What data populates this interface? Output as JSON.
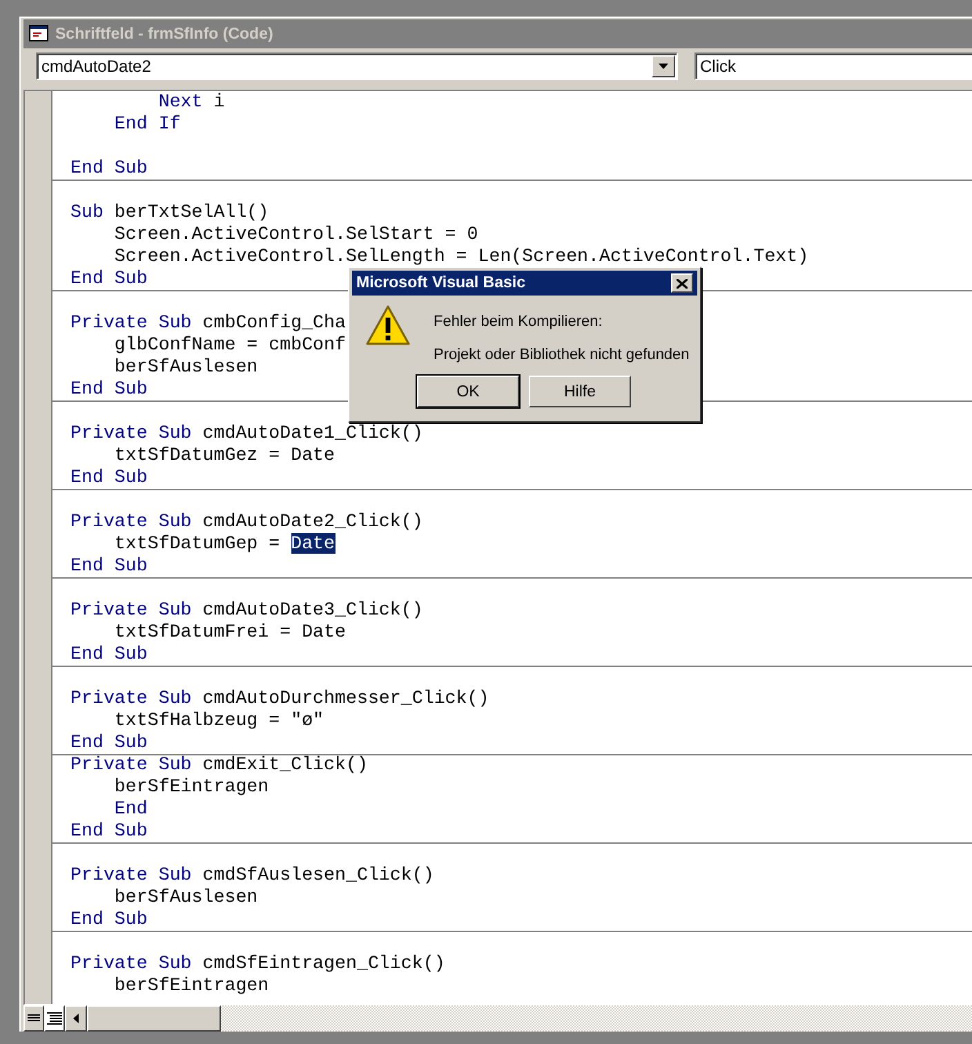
{
  "window": {
    "title": "Schriftfeld - frmSfInfo (Code)",
    "object_combo": {
      "value": "cmdAutoDate2"
    },
    "procedure_combo": {
      "value": "Click"
    }
  },
  "code_blocks": [
    {
      "lines": [
        {
          "kind": "code",
          "tokens": [
            {
              "kind": "keyword",
              "text": "        Next"
            },
            {
              "kind": "text",
              "text": " i"
            }
          ]
        },
        {
          "kind": "code",
          "tokens": [
            {
              "kind": "keyword",
              "text": "    End If"
            }
          ]
        },
        {
          "kind": "blank"
        },
        {
          "kind": "code",
          "tokens": [
            {
              "kind": "keyword",
              "text": "End Sub"
            }
          ]
        }
      ]
    },
    {
      "lines": [
        {
          "kind": "blank"
        },
        {
          "kind": "code",
          "tokens": [
            {
              "kind": "keyword",
              "text": "Sub"
            },
            {
              "kind": "text",
              "text": " berTxtSelAll()"
            }
          ]
        },
        {
          "kind": "code",
          "tokens": [
            {
              "kind": "text",
              "text": "    Screen.ActiveControl.SelStart = 0"
            }
          ]
        },
        {
          "kind": "code",
          "tokens": [
            {
              "kind": "text",
              "text": "    Screen.ActiveControl.SelLength = Len(Screen.ActiveControl.Text)"
            }
          ]
        },
        {
          "kind": "code",
          "tokens": [
            {
              "kind": "keyword",
              "text": "End Sub"
            }
          ]
        }
      ]
    },
    {
      "lines": [
        {
          "kind": "blank"
        },
        {
          "kind": "code",
          "tokens": [
            {
              "kind": "keyword",
              "text": "Private Sub"
            },
            {
              "kind": "text",
              "text": " cmbConfig_Cha"
            }
          ]
        },
        {
          "kind": "code",
          "tokens": [
            {
              "kind": "text",
              "text": "    glbConfName = cmbConf"
            }
          ]
        },
        {
          "kind": "code",
          "tokens": [
            {
              "kind": "text",
              "text": "    berSfAuslesen"
            }
          ]
        },
        {
          "kind": "code",
          "tokens": [
            {
              "kind": "keyword",
              "text": "End Sub"
            }
          ]
        }
      ]
    },
    {
      "lines": [
        {
          "kind": "blank"
        },
        {
          "kind": "code",
          "tokens": [
            {
              "kind": "keyword",
              "text": "Private Sub"
            },
            {
              "kind": "text",
              "text": " cmdAutoDate1_Click()"
            }
          ]
        },
        {
          "kind": "code",
          "tokens": [
            {
              "kind": "text",
              "text": "    txtSfDatumGez = Date"
            }
          ]
        },
        {
          "kind": "code",
          "tokens": [
            {
              "kind": "keyword",
              "text": "End Sub"
            }
          ]
        }
      ]
    },
    {
      "lines": [
        {
          "kind": "blank"
        },
        {
          "kind": "code",
          "tokens": [
            {
              "kind": "keyword",
              "text": "Private Sub"
            },
            {
              "kind": "text",
              "text": " cmdAutoDate2_Click()"
            }
          ]
        },
        {
          "kind": "code",
          "tokens": [
            {
              "kind": "text",
              "text": "    txtSfDatumGep = "
            },
            {
              "kind": "selection",
              "text": "Date"
            }
          ]
        },
        {
          "kind": "code",
          "tokens": [
            {
              "kind": "keyword",
              "text": "End Sub"
            }
          ]
        }
      ]
    },
    {
      "lines": [
        {
          "kind": "blank"
        },
        {
          "kind": "code",
          "tokens": [
            {
              "kind": "keyword",
              "text": "Private Sub"
            },
            {
              "kind": "text",
              "text": " cmdAutoDate3_Click()"
            }
          ]
        },
        {
          "kind": "code",
          "tokens": [
            {
              "kind": "text",
              "text": "    txtSfDatumFrei = Date"
            }
          ]
        },
        {
          "kind": "code",
          "tokens": [
            {
              "kind": "keyword",
              "text": "End Sub"
            }
          ]
        }
      ]
    },
    {
      "lines": [
        {
          "kind": "blank"
        },
        {
          "kind": "code",
          "tokens": [
            {
              "kind": "keyword",
              "text": "Private Sub"
            },
            {
              "kind": "text",
              "text": " cmdAutoDurchmesser_Click()"
            }
          ]
        },
        {
          "kind": "code",
          "tokens": [
            {
              "kind": "text",
              "text": "    txtSfHalbzeug = \"ø\""
            }
          ]
        },
        {
          "kind": "code",
          "tokens": [
            {
              "kind": "keyword",
              "text": "End Sub"
            }
          ]
        }
      ]
    },
    {
      "lines": [
        {
          "kind": "code",
          "tokens": [
            {
              "kind": "keyword",
              "text": "Private Sub"
            },
            {
              "kind": "text",
              "text": " cmdExit_Click()"
            }
          ]
        },
        {
          "kind": "code",
          "tokens": [
            {
              "kind": "text",
              "text": "    berSfEintragen"
            }
          ]
        },
        {
          "kind": "code",
          "tokens": [
            {
              "kind": "keyword",
              "text": "    End"
            }
          ]
        },
        {
          "kind": "code",
          "tokens": [
            {
              "kind": "keyword",
              "text": "End Sub"
            }
          ]
        }
      ]
    },
    {
      "lines": [
        {
          "kind": "blank"
        },
        {
          "kind": "code",
          "tokens": [
            {
              "kind": "keyword",
              "text": "Private Sub"
            },
            {
              "kind": "text",
              "text": " cmdSfAuslesen_Click()"
            }
          ]
        },
        {
          "kind": "code",
          "tokens": [
            {
              "kind": "text",
              "text": "    berSfAuslesen"
            }
          ]
        },
        {
          "kind": "code",
          "tokens": [
            {
              "kind": "keyword",
              "text": "End Sub"
            }
          ]
        }
      ]
    },
    {
      "lines": [
        {
          "kind": "blank"
        },
        {
          "kind": "code",
          "tokens": [
            {
              "kind": "keyword",
              "text": "Private Sub"
            },
            {
              "kind": "text",
              "text": " cmdSfEintragen_Click()"
            }
          ]
        },
        {
          "kind": "code",
          "tokens": [
            {
              "kind": "text",
              "text": "    berSfEintragen"
            }
          ]
        }
      ]
    }
  ],
  "dialog": {
    "title": "Microsoft Visual Basic",
    "messages": [
      "Fehler beim Kompilieren:",
      "Projekt oder Bibliothek nicht gefunden"
    ],
    "buttons": [
      {
        "label": "OK",
        "default": true
      },
      {
        "label": "Hilfe",
        "default": false
      }
    ]
  }
}
